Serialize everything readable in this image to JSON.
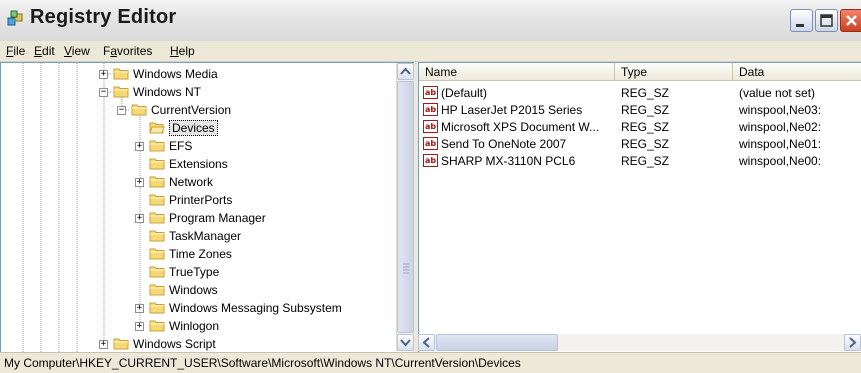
{
  "window": {
    "title": "Registry Editor"
  },
  "menu": [
    {
      "label_rest": "ile",
      "accel": "F"
    },
    {
      "label_rest": "dit",
      "accel": "E"
    },
    {
      "label_rest": "iew",
      "accel": "V"
    },
    {
      "label_pre": "F",
      "accel": "a",
      "label_rest": "vorites"
    },
    {
      "label_rest": "elp",
      "accel": "H"
    }
  ],
  "tree": {
    "items": [
      {
        "label": "Windows Media",
        "expander": "+"
      },
      {
        "label": "Windows NT",
        "expander": "−"
      },
      {
        "label": "CurrentVersion",
        "expander": "−"
      },
      {
        "label": "Devices",
        "expander": "",
        "selected": true
      },
      {
        "label": "EFS",
        "expander": "+"
      },
      {
        "label": "Extensions",
        "expander": ""
      },
      {
        "label": "Network",
        "expander": "+"
      },
      {
        "label": "PrinterPorts",
        "expander": ""
      },
      {
        "label": "Program Manager",
        "expander": "+"
      },
      {
        "label": "TaskManager",
        "expander": ""
      },
      {
        "label": "Time Zones",
        "expander": ""
      },
      {
        "label": "TrueType",
        "expander": ""
      },
      {
        "label": "Windows",
        "expander": ""
      },
      {
        "label": "Windows Messaging Subsystem",
        "expander": "+"
      },
      {
        "label": "Winlogon",
        "expander": "+"
      },
      {
        "label": "Windows Script",
        "expander": "+"
      }
    ]
  },
  "list": {
    "columns": [
      "Name",
      "Type",
      "Data"
    ],
    "rows": [
      {
        "name": "(Default)",
        "type": "REG_SZ",
        "data": "(value not set)"
      },
      {
        "name": "HP LaserJet P2015 Series",
        "type": "REG_SZ",
        "data": "winspool,Ne03:"
      },
      {
        "name": "Microsoft XPS Document W...",
        "type": "REG_SZ",
        "data": "winspool,Ne02:"
      },
      {
        "name": "Send To OneNote 2007",
        "type": "REG_SZ",
        "data": "winspool,Ne01:"
      },
      {
        "name": "SHARP MX-3110N PCL6",
        "type": "REG_SZ",
        "data": "winspool,Ne00:"
      }
    ],
    "value_icon_text": "ab"
  },
  "status": {
    "path": "My Computer\\HKEY_CURRENT_USER\\Software\\Microsoft\\Windows NT\\CurrentVersion\\Devices"
  },
  "icons": {
    "app": "registry-editor-icon",
    "minimize": "minimize-icon",
    "maximize": "maximize-icon",
    "close": "close-icon",
    "folder": "folder-icon",
    "value": "string-value-icon"
  },
  "colors": {
    "folder_fill": "#f5d977",
    "folder_edge": "#c9a23a",
    "close_button": "#c94021"
  }
}
